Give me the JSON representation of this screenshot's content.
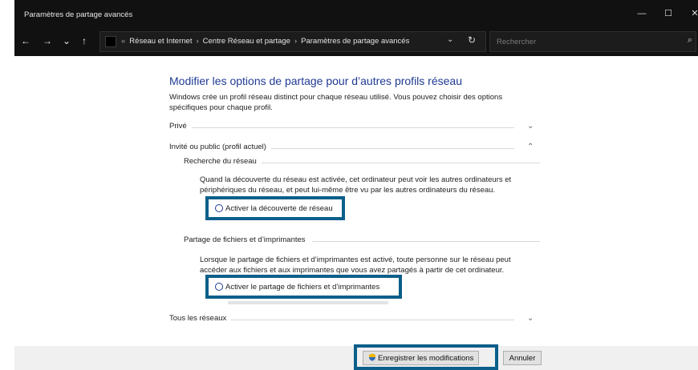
{
  "window": {
    "title": "Paramètres de partage avancés",
    "controls": {
      "minimize": "—",
      "maximize": "☐",
      "close": "✕"
    }
  },
  "nav": {
    "back": "←",
    "forward": "→",
    "recent": "⌄",
    "up": "↑",
    "breadcrumb_prefix": "«",
    "breadcrumb": [
      "Réseau et Internet",
      "Centre Réseau et partage",
      "Paramètres de partage avancés"
    ],
    "separator": "›",
    "dropdown": "⌄",
    "refresh": "↻",
    "search_placeholder": "Rechercher",
    "search_icon": "⌕"
  },
  "main": {
    "heading": "Modifier les options de partage pour d’autres profils réseau",
    "description": "Windows crée un profil réseau distinct pour chaque réseau utilisé. Vous pouvez choisir des options spécifiques pour chaque profil.",
    "sections": {
      "prive": {
        "label": "Privé",
        "chevron": "⌄"
      },
      "invite": {
        "label": "Invité ou public (profil actuel)",
        "chevron": "⌃"
      },
      "tous": {
        "label": "Tous les réseaux",
        "chevron": "⌄"
      }
    },
    "network_discovery": {
      "title": "Recherche du réseau",
      "text": "Quand la découverte du réseau est activée, cet ordinateur peut voir les autres ordinateurs et périphériques du réseau, et peut lui-même être vu par les autres ordinateurs du réseau.",
      "option": "Activer la découverte de réseau"
    },
    "file_sharing": {
      "title": "Partage de fichiers et d’imprimantes",
      "text": "Lorsque le partage de fichiers et d’imprimantes est activé, toute personne sur le réseau peut accéder aux fichiers et aux imprimantes que vous avez partagés à partir de cet ordinateur.",
      "option": "Activer le partage de fichiers et d’imprimantes"
    }
  },
  "footer": {
    "save": "Enregistrer les modifications",
    "cancel": "Annuler"
  },
  "colors": {
    "heading": "#1f3a93",
    "highlight": "#0b5f8a",
    "titlebar": "#111111"
  }
}
